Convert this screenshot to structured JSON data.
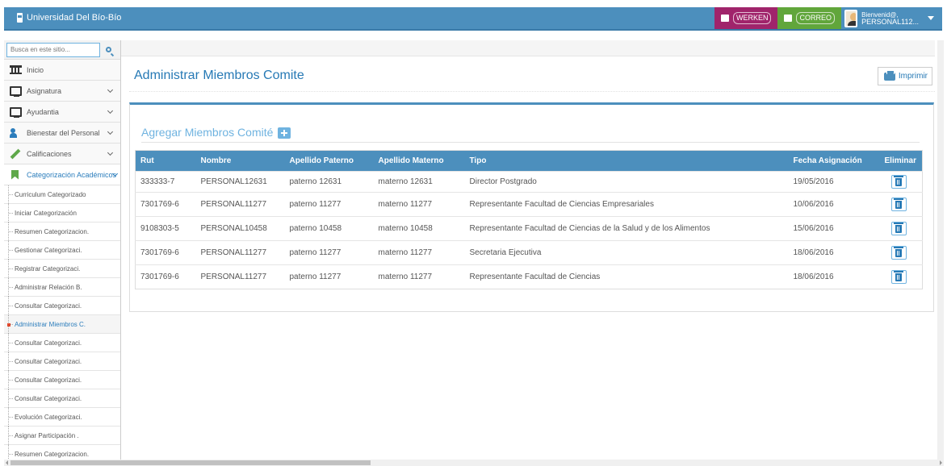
{
  "header": {
    "brand": "Universidad Del Bío-Bío",
    "werken": "WERKEN",
    "correo": "CORREO",
    "user_greeting": "Bienvenid@,",
    "user_name": "PERSONAL112..."
  },
  "sidebar": {
    "search_placeholder": "Busca en este sitio...",
    "items": [
      {
        "label": "Inicio",
        "icon": "bank-icon"
      },
      {
        "label": "Asignatura",
        "icon": "desktop-icon"
      },
      {
        "label": "Ayudantia",
        "icon": "desktop-icon"
      },
      {
        "label": "Bienestar del Personal",
        "icon": "users-icon"
      },
      {
        "label": "Calificaciones",
        "icon": "pencil-icon"
      },
      {
        "label": "Categorización Académicos",
        "icon": "bookmark-icon"
      }
    ],
    "subitems": [
      "Curriculum Categorizado",
      "Iniciar Categorización",
      "Resumen Categorizacion.",
      "Gestionar Categorizaci.",
      "Registrar Categorizaci.",
      "Administrar Relación B.",
      "Consultar Categorizaci.",
      "Administrar Miembros C.",
      "Consultar Categorizaci.",
      "Consultar Categorizaci.",
      "Consultar Categorizaci.",
      "Consultar Categorizaci.",
      "Evolución Categorizaci.",
      "Asignar Participación .",
      "Resumen Categorizacion."
    ]
  },
  "main": {
    "title": "Administrar Miembros Comite",
    "print_label": "Imprimir",
    "add_title": "Agregar Miembros Comité",
    "columns": [
      "Rut",
      "Nombre",
      "Apellido Paterno",
      "Apellido Materno",
      "Tipo",
      "Fecha Asignación",
      "Eliminar"
    ],
    "rows": [
      {
        "rut": "333333-7",
        "nombre": "PERSONAL12631",
        "paterno": "paterno 12631",
        "materno": "materno 12631",
        "tipo": "Director Postgrado",
        "fecha": "19/05/2016"
      },
      {
        "rut": "7301769-6",
        "nombre": "PERSONAL11277",
        "paterno": "paterno 11277",
        "materno": "materno 11277",
        "tipo": "Representante Facultad de Ciencias Empresariales",
        "fecha": "10/06/2016"
      },
      {
        "rut": "9108303-5",
        "nombre": "PERSONAL10458",
        "paterno": "paterno 10458",
        "materno": "materno 10458",
        "tipo": "Representante Facultad de Ciencias de la Salud y de los Alimentos",
        "fecha": "15/06/2016"
      },
      {
        "rut": "7301769-6",
        "nombre": "PERSONAL11277",
        "paterno": "paterno 11277",
        "materno": "materno 11277",
        "tipo": "Secretaria Ejecutiva",
        "fecha": "18/06/2016"
      },
      {
        "rut": "7301769-6",
        "nombre": "PERSONAL11277",
        "paterno": "paterno 11277",
        "materno": "materno 11277",
        "tipo": "Representante Facultad de Ciencias",
        "fecha": "18/06/2016"
      }
    ]
  },
  "colors": {
    "primary": "#4c8fbd",
    "link": "#2679b5",
    "werken": "#a0246b",
    "correo": "#61a63b"
  }
}
